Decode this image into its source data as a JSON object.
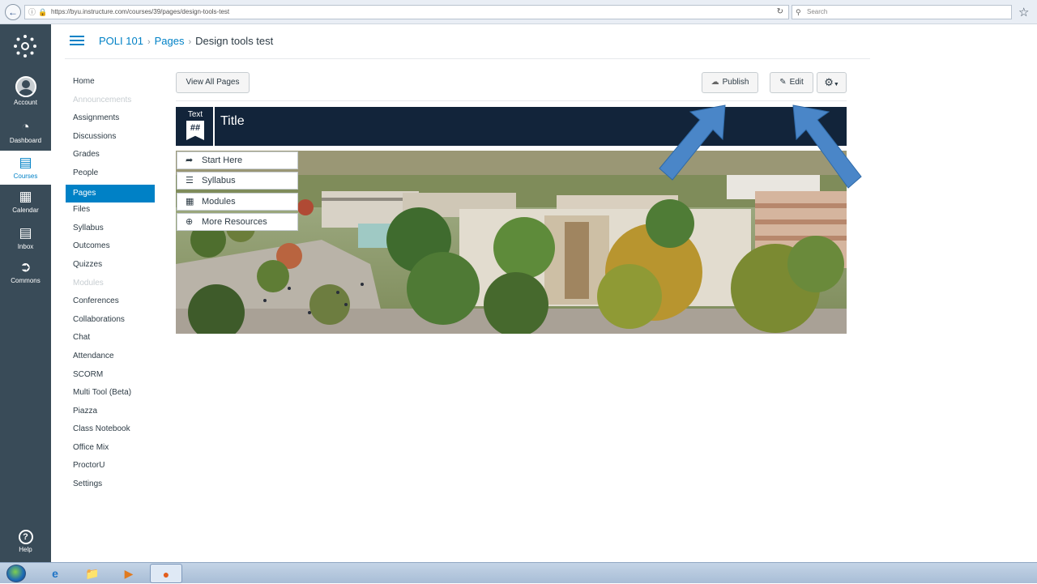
{
  "browser": {
    "url": "https://byu.instructure.com/courses/39/pages/design-tools-test",
    "search_placeholder": "Search"
  },
  "global_nav": {
    "account": "Account",
    "dashboard": "Dashboard",
    "courses": "Courses",
    "calendar": "Calendar",
    "inbox": "Inbox",
    "commons": "Commons",
    "help": "Help"
  },
  "breadcrumb": {
    "course": "POLI 101",
    "section": "Pages",
    "page": "Design tools test"
  },
  "course_nav": [
    {
      "label": "Home",
      "state": "normal"
    },
    {
      "label": "Announcements",
      "state": "disabled"
    },
    {
      "label": "Assignments",
      "state": "normal"
    },
    {
      "label": "Discussions",
      "state": "normal"
    },
    {
      "label": "Grades",
      "state": "normal"
    },
    {
      "label": "People",
      "state": "normal"
    },
    {
      "label": "Pages",
      "state": "active"
    },
    {
      "label": "Files",
      "state": "normal"
    },
    {
      "label": "Syllabus",
      "state": "normal"
    },
    {
      "label": "Outcomes",
      "state": "normal"
    },
    {
      "label": "Quizzes",
      "state": "normal"
    },
    {
      "label": "Modules",
      "state": "disabled"
    },
    {
      "label": "Conferences",
      "state": "normal"
    },
    {
      "label": "Collaborations",
      "state": "normal"
    },
    {
      "label": "Chat",
      "state": "normal"
    },
    {
      "label": "Attendance",
      "state": "normal"
    },
    {
      "label": "SCORM",
      "state": "normal"
    },
    {
      "label": "Multi Tool (Beta)",
      "state": "normal"
    },
    {
      "label": "Piazza",
      "state": "normal"
    },
    {
      "label": "Class Notebook",
      "state": "normal"
    },
    {
      "label": "Office Mix",
      "state": "normal"
    },
    {
      "label": "ProctorU",
      "state": "normal"
    },
    {
      "label": "Settings",
      "state": "normal"
    }
  ],
  "toolbar": {
    "view_all_pages": "View All Pages",
    "publish": "Publish",
    "edit": "Edit"
  },
  "content": {
    "badge_label": "Text",
    "badge_symbol": "##",
    "title": "Title",
    "links": [
      {
        "label": "Start Here",
        "icon": "share-arrow-icon"
      },
      {
        "label": "Syllabus",
        "icon": "list-icon"
      },
      {
        "label": "Modules",
        "icon": "modules-icon"
      },
      {
        "label": "More Resources",
        "icon": "plus-circle-icon"
      }
    ]
  },
  "colors": {
    "nav_bg": "#394b58",
    "accent": "#0081c6",
    "banner_bg": "#12243a",
    "arrow": "#4a86c8"
  }
}
